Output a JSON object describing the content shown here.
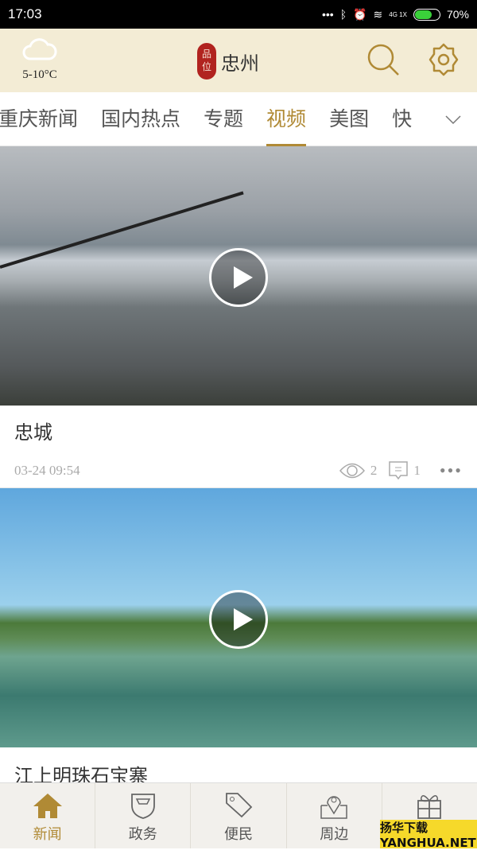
{
  "status_bar": {
    "time": "17:03",
    "network": "4G 1X",
    "battery": "70%",
    "battery_level": 0.7
  },
  "header": {
    "weather_temp": "5-10°C",
    "logo_seal": "品位",
    "app_name": "忠州"
  },
  "tabs": [
    {
      "label": "重庆新闻"
    },
    {
      "label": "国内热点"
    },
    {
      "label": "专题"
    },
    {
      "label": "视频",
      "active": true
    },
    {
      "label": "美图"
    },
    {
      "label": "快"
    }
  ],
  "feed": [
    {
      "title": "忠城",
      "date": "03-24 09:54",
      "views": "2",
      "comments": "1"
    },
    {
      "title": "江上明珠石宝寨"
    }
  ],
  "bottom_nav": [
    {
      "label": "新闻",
      "active": true
    },
    {
      "label": "政务"
    },
    {
      "label": "便民"
    },
    {
      "label": "周边"
    },
    {
      "label": "福利"
    }
  ],
  "watermark": "扬华下载 YANGHUA.NET",
  "accent_color": "#b08a35"
}
